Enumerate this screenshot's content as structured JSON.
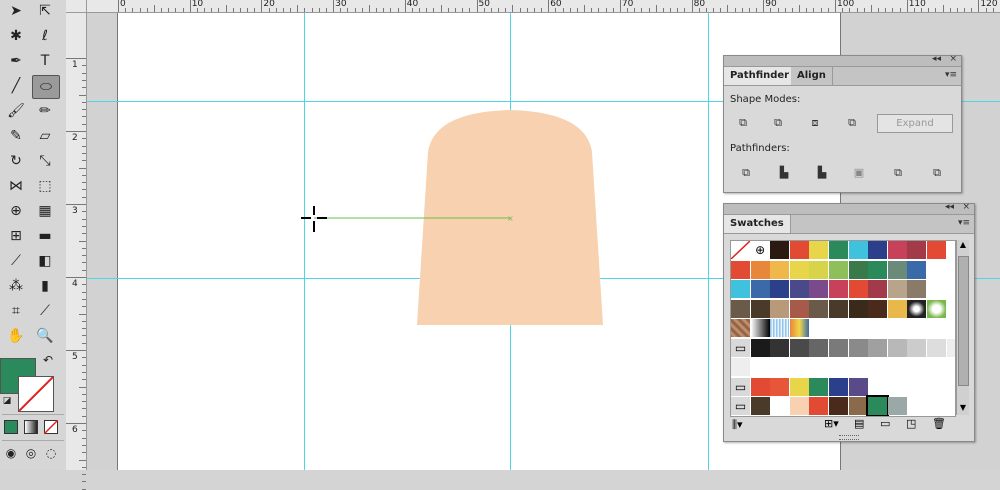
{
  "colors": {
    "shape_fill": "#f7d1b0",
    "guide": "#4fd6e6",
    "fill_color": "#2a8a5c",
    "path_line": "#6cbf4a"
  },
  "toolbox": {
    "tools": [
      "selection-tool",
      "direct-selection-tool",
      "magic-wand-tool",
      "lasso-tool",
      "pen-tool",
      "type-tool",
      "line-segment-tool",
      "ellipse-tool",
      "paintbrush-tool",
      "pencil-tool",
      "blob-brush-tool",
      "eraser-tool",
      "rotate-tool",
      "scale-tool",
      "width-tool",
      "free-transform-tool",
      "shape-builder-tool",
      "perspective-grid-tool",
      "mesh-tool",
      "gradient-tool",
      "eyedropper-tool",
      "blend-tool",
      "symbol-sprayer-tool",
      "column-graph-tool",
      "artboard-tool",
      "slice-tool",
      "hand-tool",
      "zoom-tool"
    ],
    "selected_tool": "ellipse-tool"
  },
  "ruler": {
    "top_labels": [
      "0",
      "10",
      "20",
      "30",
      "40",
      "50",
      "60",
      "70",
      "80",
      "90",
      "100",
      "110",
      "120"
    ],
    "left_labels": [
      "1",
      "2",
      "3",
      "4",
      "5",
      "6"
    ]
  },
  "pathfinder_panel": {
    "tabs": [
      "Pathfinder",
      "Align"
    ],
    "active_tab": "Pathfinder",
    "shape_modes_label": "Shape Modes:",
    "pathfinders_label": "Pathfinders:",
    "expand_label": "Expand",
    "shape_mode_icons": [
      "unite-icon",
      "minus-front-icon",
      "intersect-icon",
      "exclude-icon"
    ],
    "pathfinder_icons": [
      "divide-icon",
      "trim-icon",
      "merge-icon",
      "crop-icon",
      "outline-icon",
      "minus-back-icon"
    ]
  },
  "swatches_panel": {
    "tab": "Swatches",
    "rows": [
      [
        "none",
        "registration",
        "#2b1a12",
        "#e24a33",
        "#e9d54a",
        "#2a8a5c",
        "#3fc2de",
        "#2b3f8a",
        "#c8415a",
        "#a33a4a",
        "#e24a33"
      ],
      [
        "#e24a33",
        "#e8863a",
        "#f0b84a",
        "#e9d54a",
        "#d8d44a",
        "#8fbf5a",
        "#3a7a4a",
        "#2a8a5c",
        "#6a8a7a",
        "#3a6aa8"
      ],
      [
        "#3fc2de",
        "#3a6aa8",
        "#2b3f8a",
        "#4a4a8a",
        "#7a4a8a",
        "#c8415a",
        "#e24a33",
        "#a33a4a",
        "#b8a48a",
        "#8a7a6a"
      ],
      [
        "#6a5a4a",
        "#4a3a2a",
        "#b89a7a",
        "#a85a4a",
        "#6a5a4a",
        "#4a3a2a",
        "#3a2a1a",
        "#4a2a1a",
        "#e8b84a",
        "pattern-dots",
        "pattern-leaf"
      ],
      [
        "pattern-texture",
        "gradient-bw",
        "gradient-blue",
        "gradient-orange"
      ],
      [
        "folder",
        "#1a1a1a",
        "#333333",
        "#4a4a4a",
        "#666666",
        "#7a7a7a",
        "#8a8a8a",
        "#a0a0a0",
        "#b8b8b8",
        "#cccccc",
        "#dddddd",
        "#eeeeee"
      ],
      [
        "#eeeeee"
      ],
      [
        "folder",
        "#e24a33",
        "#e8563a",
        "#e9d54a",
        "#2a8a5c",
        "#2b3f8a",
        "#5a4a8a"
      ],
      [
        "folder",
        "#4a3a2a",
        "#ffffff",
        "#f7d1b0",
        "#e24a33",
        "#4a2a1a",
        "#8a6a4a",
        "#2a8a5c",
        "#9aa8a8"
      ]
    ],
    "footer_icons": [
      "swatch-libraries-icon",
      "show-swatch-kinds-icon",
      "swatch-options-icon",
      "new-color-group-icon",
      "new-swatch-icon",
      "delete-swatch-icon"
    ]
  }
}
